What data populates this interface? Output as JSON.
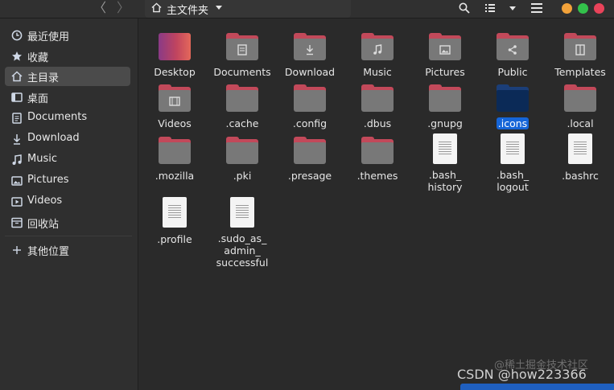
{
  "header": {
    "back_glyph": "〈",
    "forward_glyph": "〉",
    "path_label": "主文件夹",
    "icons": [
      "home-icon",
      "search-icon",
      "list-view-icon",
      "sort-dropdown-icon",
      "hamburger-menu-icon"
    ],
    "window_button_colors": {
      "minimize": "#f2a23a",
      "maximize": "#33c14b",
      "close": "#e9435a"
    }
  },
  "sidebar": {
    "items": [
      {
        "label": "最近使用",
        "icon": "clock-icon"
      },
      {
        "label": "收藏",
        "icon": "star-icon"
      },
      {
        "label": "主目录",
        "icon": "home-icon",
        "active": true
      },
      {
        "label": "桌面",
        "icon": "desktop-icon"
      },
      {
        "label": "Documents",
        "icon": "document-icon"
      },
      {
        "label": "Download",
        "icon": "download-icon"
      },
      {
        "label": "Music",
        "icon": "music-icon"
      },
      {
        "label": "Pictures",
        "icon": "picture-icon"
      },
      {
        "label": "Videos",
        "icon": "video-icon"
      },
      {
        "label": "回收站",
        "icon": "trash-icon"
      },
      {
        "label": "其他位置",
        "icon": "plus-icon"
      }
    ]
  },
  "files": [
    {
      "name": "Desktop",
      "kind": "desktop"
    },
    {
      "name": "Documents",
      "kind": "folder",
      "emblem": "document"
    },
    {
      "name": "Download",
      "kind": "folder",
      "emblem": "download"
    },
    {
      "name": "Music",
      "kind": "folder",
      "emblem": "music"
    },
    {
      "name": "Pictures",
      "kind": "folder",
      "emblem": "picture"
    },
    {
      "name": "Public",
      "kind": "folder",
      "emblem": "share"
    },
    {
      "name": "Templates",
      "kind": "folder",
      "emblem": "template"
    },
    {
      "name": "Videos",
      "kind": "folder",
      "emblem": "video"
    },
    {
      "name": ".cache",
      "kind": "folder"
    },
    {
      "name": ".config",
      "kind": "folder"
    },
    {
      "name": ".dbus",
      "kind": "folder"
    },
    {
      "name": ".gnupg",
      "kind": "folder"
    },
    {
      "name": ".icons",
      "kind": "folder",
      "selected": true
    },
    {
      "name": ".local",
      "kind": "folder"
    },
    {
      "name": ".mozilla",
      "kind": "folder"
    },
    {
      "name": ".pki",
      "kind": "folder"
    },
    {
      "name": ".presage",
      "kind": "folder"
    },
    {
      "name": ".themes",
      "kind": "folder"
    },
    {
      "name": ".bash_ history",
      "kind": "file"
    },
    {
      "name": ".bash_ logout",
      "kind": "file"
    },
    {
      "name": ".bashrc",
      "kind": "file"
    },
    {
      "name": ".profile",
      "kind": "file"
    },
    {
      "name": ".sudo_as_ admin_ successful",
      "kind": "file"
    }
  ],
  "colors": {
    "folder_tab": "#c2495a",
    "folder_body": "#787878",
    "selection": "#1565d8"
  },
  "watermark": {
    "line1": "@稀土掘金技术社区",
    "line2": "CSDN @how223366"
  }
}
